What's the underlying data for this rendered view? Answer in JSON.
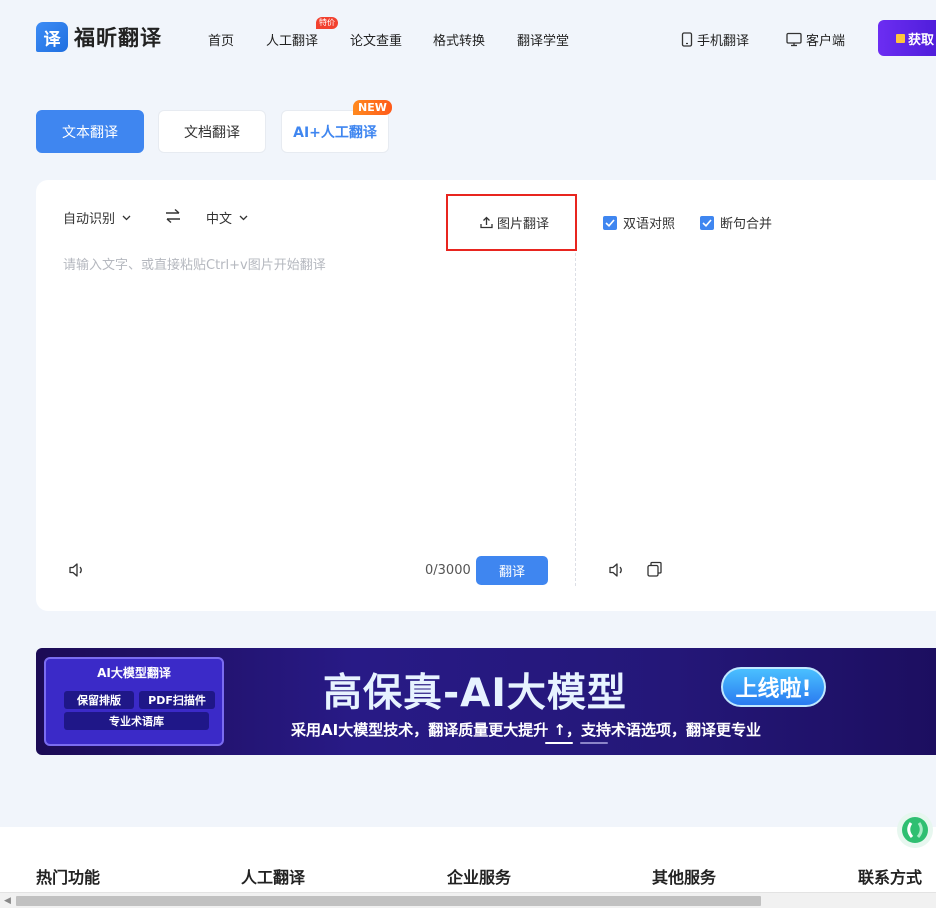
{
  "header": {
    "logo_mark": "译",
    "logo_text": "福昕翻译",
    "nav": [
      "首页",
      "人工翻译",
      "论文查重",
      "格式转换",
      "翻译学堂"
    ],
    "hot_badge": "特价",
    "mobile_label": "手机翻译",
    "client_label": "客户端",
    "get_button": "获取"
  },
  "tabs": {
    "text": "文本翻译",
    "doc": "文档翻译",
    "ai": "AI+人工翻译",
    "new_badge": "NEW"
  },
  "editor": {
    "source_lang": "自动识别",
    "target_lang": "中文",
    "image_translate": "图片翻译",
    "placeholder": "请输入文字、或直接粘贴Ctrl+v图片开始翻译",
    "counter": "0/3000",
    "translate_button": "翻译",
    "bilingual": "双语对照",
    "merge_sentences": "断句合并"
  },
  "banner": {
    "chip_title": "AI大模型翻译",
    "chip_items": [
      "保留排版",
      "PDF扫描件",
      "专业术语库"
    ],
    "title": "高保真-AI大模型",
    "pill": "上线啦!",
    "subtitle": "采用AI大模型技术，翻译质量更大提升 ↑，支持术语选项，翻译更专业"
  },
  "footer": {
    "columns": [
      "热门功能",
      "人工翻译",
      "企业服务",
      "其他服务",
      "联系方式"
    ]
  },
  "colors": {
    "primary": "#3f86f0",
    "highlight_box": "#e8251f",
    "banner_bg": "#281a86",
    "purple_button": "#6c2df2"
  }
}
